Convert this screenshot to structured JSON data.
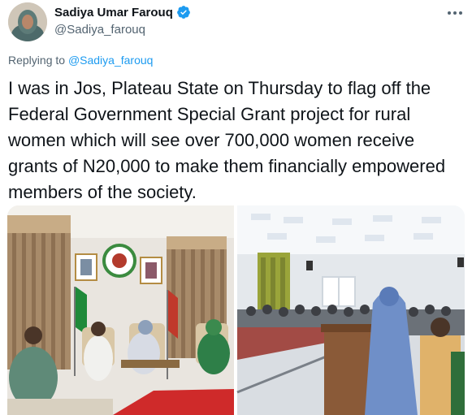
{
  "author": {
    "name": "Sadiya Umar Farouq",
    "handle": "@Sadiya_farouq",
    "verified_icon": "verified-badge-icon"
  },
  "reply": {
    "prefix": "Replying to ",
    "handle": "@Sadiya_farouq"
  },
  "tweet": {
    "text": "I was in Jos, Plateau State on Thursday to flag off the Federal Government Special Grant project for rural women which will see over 700,000 women receive grants of N20,000 to make them financially empowered members of the society."
  },
  "colors": {
    "link": "#1d9bf0",
    "verified": "#1d9bf0",
    "secondary_text": "#536471"
  },
  "media": {
    "count": 2,
    "icons": [
      "photo-left",
      "photo-right"
    ]
  }
}
